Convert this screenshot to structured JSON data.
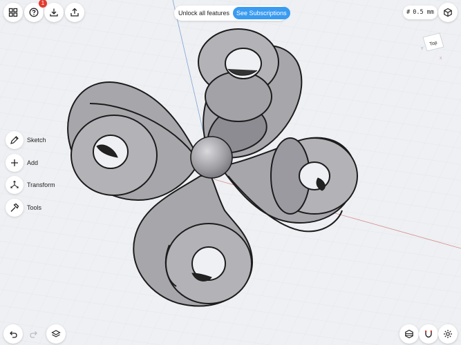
{
  "top_left": {
    "home_icon": "grid-icon",
    "help_icon": "question-icon",
    "help_badge": "1",
    "import_icon": "download-icon",
    "export_icon": "share-icon"
  },
  "promo": {
    "text": "Unlock all features",
    "button": "See Subscriptions"
  },
  "grid_size": {
    "symbol": "#",
    "value": "0.5 mm"
  },
  "top_right": {
    "view_icon": "cube-view-icon"
  },
  "view_cube": {
    "face_label": "Top",
    "axis_y": "Y",
    "axis_x": "X"
  },
  "toolbar": {
    "items": [
      {
        "label": "Sketch",
        "icon": "pencil-icon"
      },
      {
        "label": "Add",
        "icon": "plus-icon"
      },
      {
        "label": "Transform",
        "icon": "transform-icon"
      },
      {
        "label": "Tools",
        "icon": "hammer-icon"
      }
    ]
  },
  "bottom_left": {
    "undo_icon": "undo-icon",
    "redo_icon": "redo-icon",
    "layers_icon": "layers-icon"
  },
  "bottom_right": {
    "display_icon": "display-mode-icon",
    "snap_icon": "magnet-icon",
    "settings_icon": "gear-icon"
  },
  "colors": {
    "background": "#eef0f3",
    "model_fill": "#a9a8ad",
    "model_edge": "#1c1c1c",
    "accent": "#3a9bf0",
    "badge": "#e23b2e"
  }
}
